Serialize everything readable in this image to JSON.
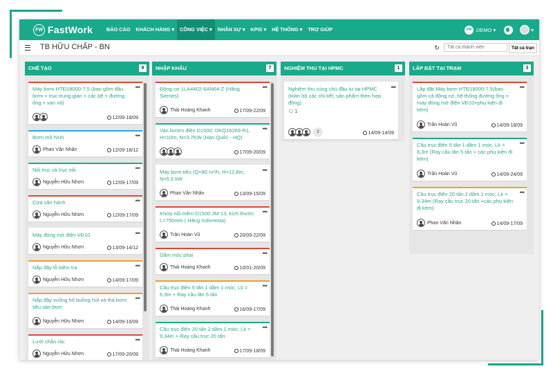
{
  "brand": {
    "logo_initials": "FW",
    "name": "FastWork"
  },
  "colors": {
    "accent": "#19a98b",
    "red": "#e0453a",
    "blue": "#2ba4e6",
    "green": "#19a98b",
    "orange": "#f39c2a"
  },
  "nav": {
    "items": [
      {
        "label": "BÁO CÁO"
      },
      {
        "label": "KHÁCH HÀNG ▾"
      },
      {
        "label": "CÔNG VIỆC ▾"
      },
      {
        "label": "NHÂN SỰ ▾"
      },
      {
        "label": "KPIS ▾"
      },
      {
        "label": "HỆ THỐNG ▾"
      },
      {
        "label": "TRỢ GIÚP"
      }
    ],
    "active_index": 2,
    "demo_badge": "FW",
    "demo_label": "DEMO ▾",
    "user_caret": "▾"
  },
  "subbar": {
    "title": "TB HỮU CHẤP - BN",
    "member_placeholder": "Tất cả thành viên",
    "all_label": "Tất cả trạn",
    "refresh_icon": "↻"
  },
  "columns": [
    {
      "title": "CHẾ TẠO",
      "count": "9",
      "cards": [
        {
          "title": "Máy bơm HTĐ18000-7,5 (bao gồm đầu bơm + trục trung gian + các bệ + đường ống + van xả)",
          "people": "",
          "avatars": 2,
          "date": "12/09-18/09",
          "color": "red"
        },
        {
          "title": "Bơm mồ hình",
          "people": "Phan Văn Nhân",
          "avatars": 1,
          "date": "12/09-18/12",
          "color": "blue"
        },
        {
          "title": "Nối trục và trục nối",
          "people": "Nguyễn Hữu Nhơn",
          "avatars": 1,
          "date": "12/09-17/09",
          "color": "green"
        },
        {
          "title": "Cửa vận hành",
          "people": "Nguyễn Hữu Nhơn",
          "avatars": 1,
          "date": "12/09-17/09",
          "color": "red"
        },
        {
          "title": "Máy đóng mở điện VĐ10",
          "people": "Nguyễn Hữu Nhơn",
          "avatars": 1,
          "date": "13/09-14/12",
          "color": "none"
        },
        {
          "title": "Nắp đậy lỗ kiểm tra",
          "people": "Nguyễn Hữu Nhơn",
          "avatars": 1,
          "date": "14/09-17/09",
          "color": "orange"
        },
        {
          "title": "Nắp đậy xuống hố buồng hút và thả bơm tiêu sàn bom",
          "people": "Nguyễn Hữu Nhơn",
          "avatars": 1,
          "date": "14/09-16/09",
          "color": "orange"
        },
        {
          "title": "Lưới chắn rác",
          "people": "Nguyễn Hữu Nhơn",
          "avatars": 1,
          "date": "17/09-20/09",
          "color": "red"
        }
      ]
    },
    {
      "title": "NHẬP KHẨU",
      "count": "7",
      "cards": [
        {
          "title": "Động cơ 1LA4402-6AN64-Z (Hãng Siemes)",
          "people": "Thái Hoàng Khanh",
          "avatars": 1,
          "date": "17/09-22/09",
          "color": "red"
        },
        {
          "title": "Van bướm điện D1500: DKQ16269-R1, H=10m, N=3,7KW (Hàn Quốc - HQ)",
          "people": "",
          "avatars": 3,
          "date": "17/09-20/09",
          "color": "green"
        },
        {
          "title": "Máy bơm tiêu (Q=90 m³/h, H=12,8m, N=5,5 kW",
          "people": "Phan Văn Nhân",
          "avatars": 1,
          "date": "13/09-15/09",
          "color": "none"
        },
        {
          "title": "Khớp nối mềm D1500 JM-13, kích thước L=750mm ( Hãng Indonesia)",
          "people": "Trần Hoàn Vũ",
          "avatars": 1,
          "date": "20/09-22/09",
          "color": "red"
        },
        {
          "title": "Dầm móc phai",
          "people": "Thái Hoàng Khanh",
          "avatars": 1,
          "date": "10/01-20/09",
          "color": "red"
        },
        {
          "title": "Cầu trục điện 5 tấn 1 dầm 1 móc; Lk = 6,3m + Ray cầu lăn 5 tấn",
          "people": "Thái Hoàng Khanh",
          "avatars": 1,
          "date": "16/09-17/09",
          "color": "orange"
        },
        {
          "title": "Cầu trục điện 20 tấn 2 dầm 1 móc; Lk = 9,34m + Ray cầu trục 20 tấn",
          "people": "Thái Hoàng Khanh",
          "avatars": 1,
          "date": "17/09-18/09",
          "color": "green"
        }
      ]
    },
    {
      "title": "NGHIỆM THU TẠI HPMC",
      "count": "1",
      "cards": [
        {
          "title": "Nghiệm thu cùng chủ đầu tư tại HPMC (toàn bộ các chi tiết, sản phẩm theo hợp đồng)",
          "people": "",
          "avatars": 3,
          "date": "14/09-14/09",
          "color": "none",
          "comments": "1",
          "extra": "2"
        }
      ]
    },
    {
      "title": "LẮP ĐẶT TẠI TRẠM",
      "count": "3",
      "cards": [
        {
          "title": "Lắp đặt Máy bơm HTĐ18000-7,5(bao gồm cả động cơ, hệ thống đường ống + máy đóng mở điện VĐ10+phụ kiện đi kèm)",
          "people": "Trần Hoàn Vũ",
          "avatars": 1,
          "date": "14/09-18/09",
          "color": "red"
        },
        {
          "title": "Cầu trục điện 5 tấn 1 dầm 1 móc; Lk = 6,3m (Ray cầu lăn 5 tấn + các phụ kiện đi kèm)",
          "people": "Trần Hoàn Vũ",
          "avatars": 1,
          "date": "14/09-24/09",
          "color": "green"
        },
        {
          "title": "Cầu trục điện 20 tấn 2 dầm 1 móc; Lk = 9,34m (Ray cầu trục 20 tấn +các phụ kiện đi kèm)",
          "people": "Phan Văn Nhân",
          "avatars": 1,
          "date": "14/09-17/09",
          "color": "orange"
        }
      ]
    }
  ]
}
